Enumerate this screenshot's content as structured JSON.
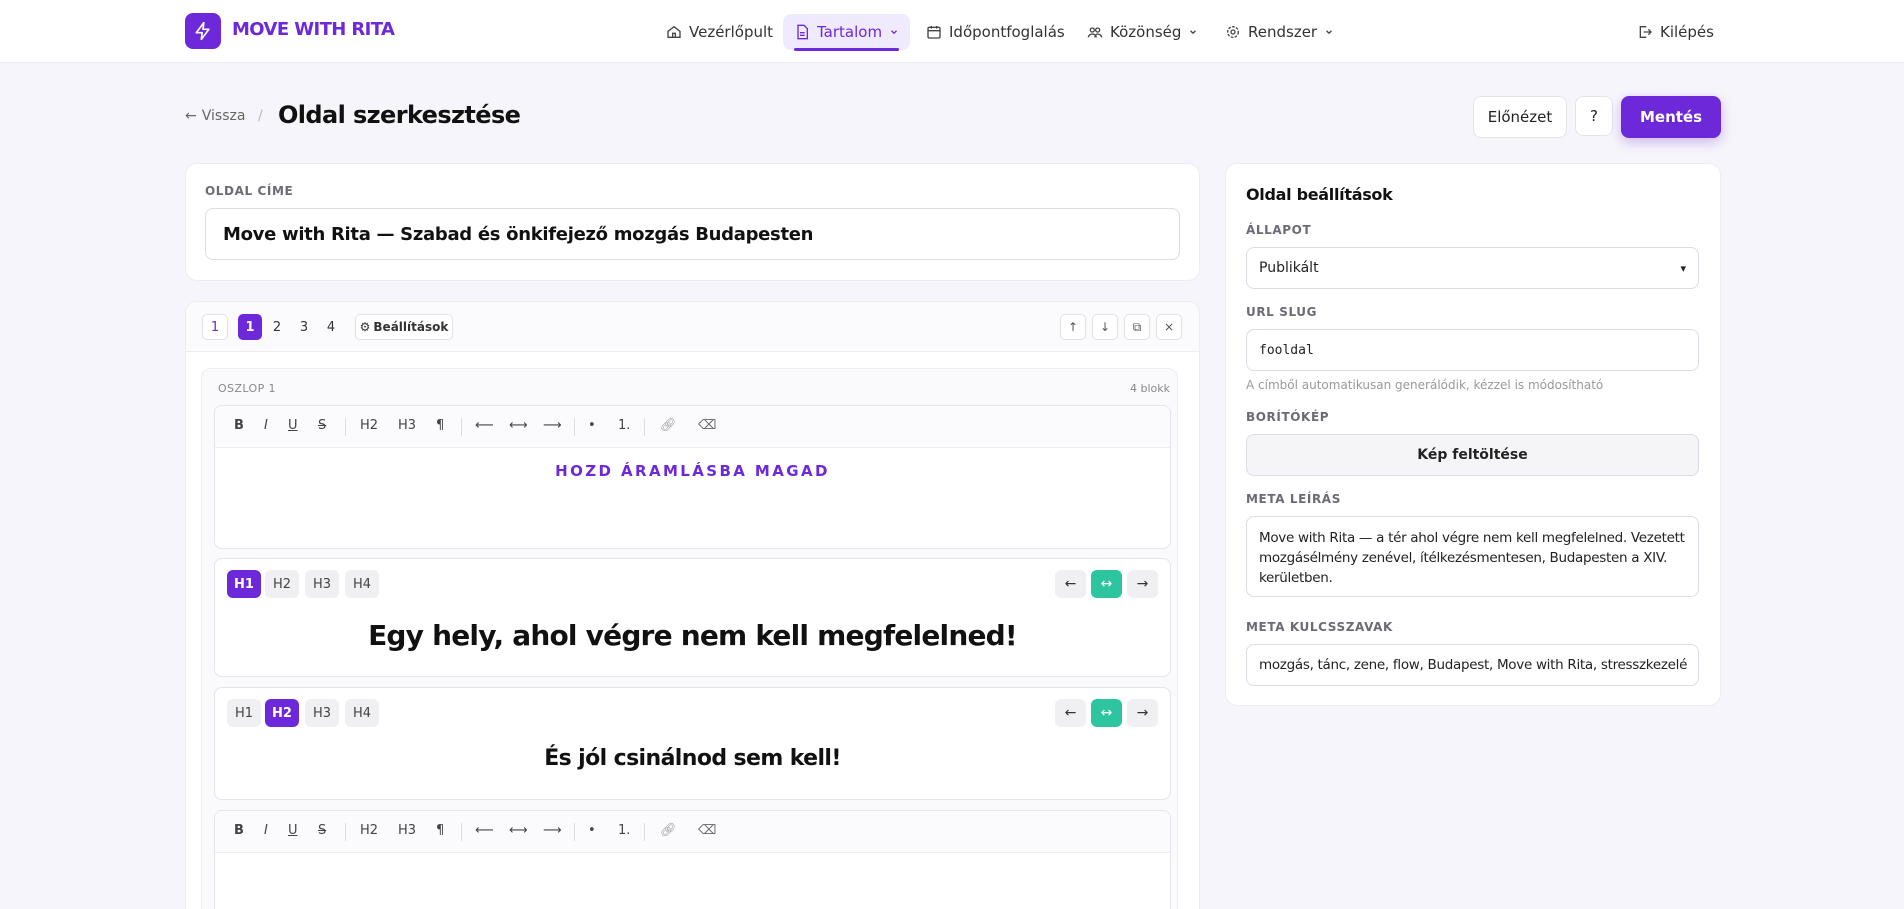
{
  "app": {
    "brand": "MOVE WITH RITA"
  },
  "nav": {
    "items": [
      {
        "label": "Vezérlőpult",
        "icon": "home-icon"
      },
      {
        "label": "Tartalom",
        "icon": "document-icon",
        "active": true
      },
      {
        "label": "Időpontfoglalás",
        "icon": "calendar-icon"
      },
      {
        "label": "Közönség",
        "icon": "users-icon"
      },
      {
        "label": "Rendszer",
        "icon": "gear-icon"
      }
    ],
    "logout": "Kilépés"
  },
  "header": {
    "back": "Vissza",
    "separator": "/",
    "title": "Oldal szerkesztése",
    "preview": "Előnézet",
    "help": "?",
    "save": "Mentés"
  },
  "title_field": {
    "label": "OLDAL CÍME",
    "value": "Move with Rita — Szabad és önkifejező mozgás Budapesten"
  },
  "editor": {
    "column_count_pill": "1",
    "column_tabs": [
      "1",
      "2",
      "3",
      "4"
    ],
    "settings": "Beállítások",
    "column_label": "OSZLOP 1",
    "block_count": "4 blokk",
    "toolbar": [
      "B",
      "I",
      "U",
      "S",
      "H2",
      "H3",
      "¶",
      "⟵",
      "⟷",
      "⟶",
      "•",
      "1."
    ],
    "headings": [
      "H1",
      "H2",
      "H3",
      "H4"
    ],
    "block1_text": "HOZD ÁRAMLÁSBA MAGAD",
    "block2_text": "Egy hely, ahol végre nem kell megfelelned!",
    "block3_text": "És jól csinálnod sem kell!"
  },
  "side": {
    "title": "Oldal beállítások",
    "status_label": "ÁLLAPOT",
    "status_value": "Publikált",
    "slug_label": "URL SLUG",
    "slug_value": "fooldal",
    "slug_hint": "A címből automatikusan generálódik, kézzel is módosítható",
    "cover_label": "BORÍTÓKÉP",
    "cover_button": "Kép feltöltése",
    "meta_desc_label": "META LEÍRÁS",
    "meta_desc_value": "Move with Rita — a tér ahol végre nem kell megfelelned. Vezetett mozgásélmény zenével, ítélkezésmentesen, Budapesten a XIV. kerületben.",
    "meta_kw_label": "META KULCSSZAVAK",
    "meta_kw_value": "mozgás, tánc, zene, flow, Budapest, Move with Rita, stresszkezelé"
  },
  "colors": {
    "accent": "#6d28d9",
    "teal": "#2dc4a0"
  }
}
